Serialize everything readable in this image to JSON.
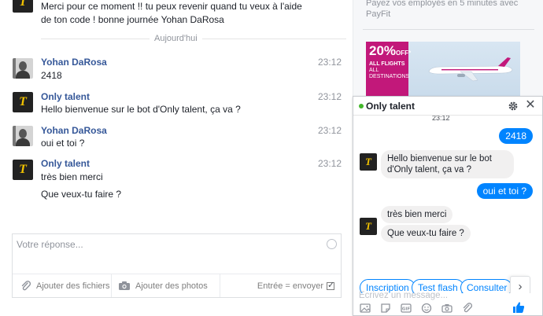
{
  "thread": {
    "previous_message": "Merci pour ce moment !! tu peux revenir quand tu veux à l'aide de ton code ! bonne journée Yohan DaRosa",
    "day_divider": "Aujourd'hui",
    "messages": [
      {
        "sender": "Yohan DaRosa",
        "time": "23:12",
        "lines": [
          "2418"
        ]
      },
      {
        "sender": "Only talent",
        "time": "23:12",
        "lines": [
          "Hello bienvenue sur le bot d'Only talent, ça va ?"
        ]
      },
      {
        "sender": "Yohan DaRosa",
        "time": "23:12",
        "lines": [
          "oui et toi ?"
        ]
      },
      {
        "sender": "Only talent",
        "time": "23:12",
        "lines": [
          "très bien merci",
          "Que veux-tu faire ?"
        ]
      }
    ],
    "brand_logo_letter": "T"
  },
  "composer": {
    "placeholder": "Votre réponse...",
    "attach_files": "Ajouter des fichiers",
    "attach_photos": "Ajouter des photos",
    "enter_to_send": "Entrée = envoyer"
  },
  "sidebar": {
    "payfit_text": "Payez vos employés en 5 minutes avec PayFit",
    "ad": {
      "percent": "20%",
      "off": "OFF*",
      "line1": "ALL FLIGHTS",
      "line2": "ALL DESTINATIONS"
    }
  },
  "chat": {
    "title": "Only talent",
    "timestamp": "23:12",
    "outgoing": [
      "2418",
      "oui et toi ?"
    ],
    "incoming": [
      "Hello bienvenue sur le bot d'Only talent, ça va ?",
      "très bien merci",
      "Que veux-tu faire ?"
    ],
    "quick_replies": [
      "Inscription",
      "Test flash",
      "Consulter le"
    ],
    "input_placeholder": "Écrivez un message...",
    "online_color": "#42b72a",
    "accent_color": "#0084ff"
  }
}
